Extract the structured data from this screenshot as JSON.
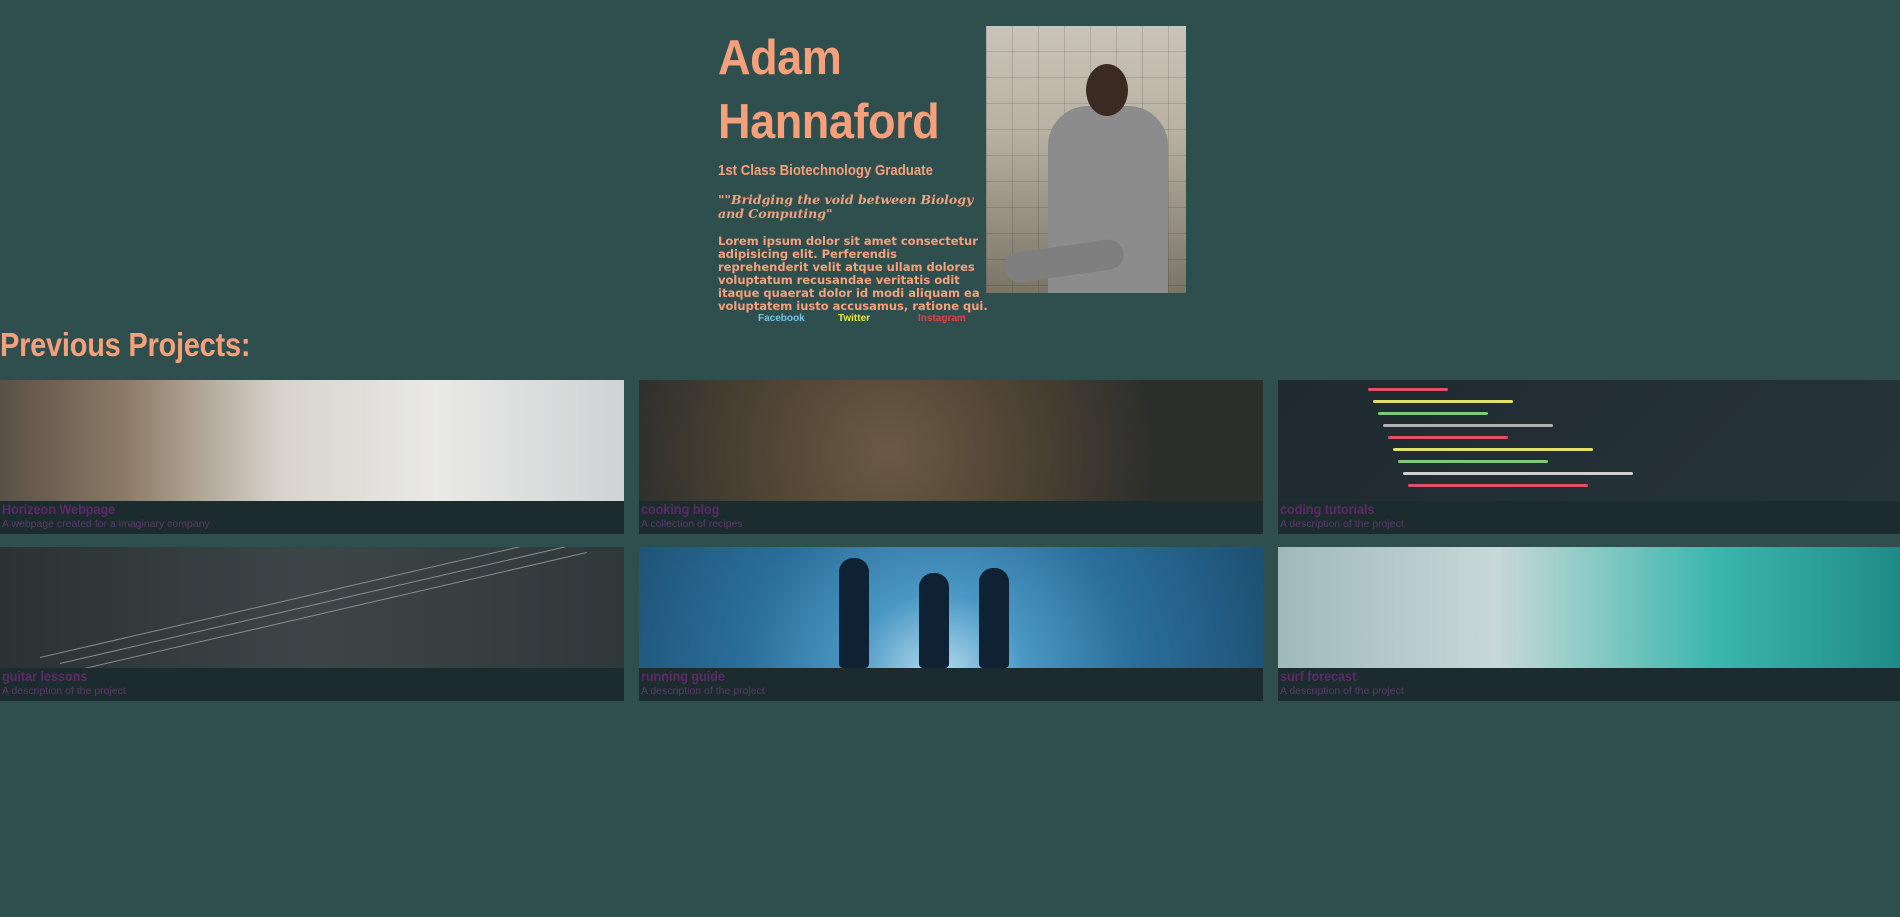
{
  "profile": {
    "first_name": "Adam",
    "last_name": "Hannaford",
    "subtitle": "1st Class Biotechnology Graduate",
    "quote": "\"\"Bridging the void between Biology and Computing\"",
    "bio": "Lorem ipsum dolor sit amet consectetur adipisicing elit. Perferendis reprehenderit velit atque ullam dolores voluptatum recusandae veritatis odit itaque quaerat dolor id modi aliquam ea voluptatem iusto accusamus, ratione qui."
  },
  "social": {
    "facebook": "Facebook",
    "twitter": "Twitter",
    "instagram": "Instagram"
  },
  "projects_heading": "Previous Projects:",
  "projects": [
    {
      "title": "Horizeon Webpage",
      "description": "A webpage created for a imaginary company"
    },
    {
      "title": "cooking blog",
      "description": "A collection of recipes"
    },
    {
      "title": "coding tutorials",
      "description": "A description of the project"
    },
    {
      "title": "guitar lessons",
      "description": "A description of the project"
    },
    {
      "title": "running guide",
      "description": "A description of the project"
    },
    {
      "title": "surf forecast",
      "description": "A description of the project"
    }
  ],
  "colors": {
    "background": "#2f4f4f",
    "accent": "#f5a07a",
    "card_title": "#5c2a66",
    "facebook": "#6ec6ea",
    "twitter": "#e6e83a",
    "instagram": "#e64040"
  }
}
